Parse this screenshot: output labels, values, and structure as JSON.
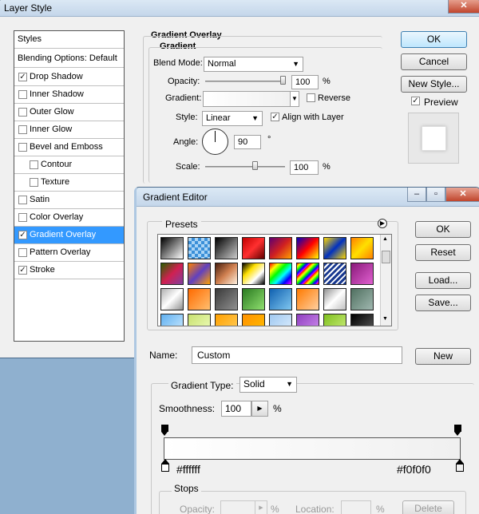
{
  "layer_style": {
    "title": "Layer Style",
    "styles_header": "Styles",
    "blending_options": "Blending Options: Default",
    "items": [
      {
        "label": "Drop Shadow",
        "checked": true,
        "indent": false,
        "selected": false
      },
      {
        "label": "Inner Shadow",
        "checked": false,
        "indent": false,
        "selected": false
      },
      {
        "label": "Outer Glow",
        "checked": false,
        "indent": false,
        "selected": false
      },
      {
        "label": "Inner Glow",
        "checked": false,
        "indent": false,
        "selected": false
      },
      {
        "label": "Bevel and Emboss",
        "checked": false,
        "indent": false,
        "selected": false
      },
      {
        "label": "Contour",
        "checked": false,
        "indent": true,
        "selected": false
      },
      {
        "label": "Texture",
        "checked": false,
        "indent": true,
        "selected": false
      },
      {
        "label": "Satin",
        "checked": false,
        "indent": false,
        "selected": false
      },
      {
        "label": "Color Overlay",
        "checked": false,
        "indent": false,
        "selected": false
      },
      {
        "label": "Gradient Overlay",
        "checked": true,
        "indent": false,
        "selected": true
      },
      {
        "label": "Pattern Overlay",
        "checked": false,
        "indent": false,
        "selected": false
      },
      {
        "label": "Stroke",
        "checked": true,
        "indent": false,
        "selected": false
      }
    ],
    "section_title": "Gradient Overlay",
    "subsection_title": "Gradient",
    "blend_mode_label": "Blend Mode:",
    "blend_mode_value": "Normal",
    "opacity_label": "Opacity:",
    "opacity_value": "100",
    "opacity_unit": "%",
    "opacity_level": 1.0,
    "gradient_label": "Gradient:",
    "reverse_label": "Reverse",
    "reverse_checked": false,
    "style_label": "Style:",
    "style_value": "Linear",
    "align_label": "Align with Layer",
    "align_checked": true,
    "angle_label": "Angle:",
    "angle_value": "90",
    "angle_unit": "°",
    "scale_label": "Scale:",
    "scale_value": "100",
    "scale_unit": "%",
    "scale_level": 0.4,
    "ok_label": "OK",
    "cancel_label": "Cancel",
    "new_style_label": "New Style...",
    "preview_label": "Preview",
    "preview_checked": true
  },
  "gradient_editor": {
    "title": "Gradient Editor",
    "presets_label": "Presets",
    "preset_swatches": [
      "linear-gradient(135deg,#000,#fff)",
      "repeating-conic-gradient(#3a8fd8 0 25%,#aad4f5 0 50%) 0 0/8px 8px",
      "linear-gradient(135deg,#000,#ccc)",
      "linear-gradient(135deg,#c00000,#ff3030,#600000)",
      "linear-gradient(135deg,#600070,#d02020,#ffa000)",
      "linear-gradient(135deg,#0000c0,#ff0000,#ffff00)",
      "linear-gradient(135deg,#ffd800,#0030c0,#ffd800)",
      "linear-gradient(135deg,#ff8000,#ffe000,#ff8000)",
      "linear-gradient(135deg,#2a6000,#d02050,#8040a0)",
      "linear-gradient(135deg,#ff8000,#6040c0,#ffa000)",
      "linear-gradient(135deg,#4a2010,#d08050,#fff0e0)",
      "linear-gradient(135deg,#000,#ffe000,#fff,#000)",
      "linear-gradient(135deg,#f00,#ff0,#0f0,#0ff,#00f,#f0f)",
      "repeating-linear-gradient(135deg,#f00,#ff0 3px,#0f0 6px,#00f 9px,#f0f 12px)",
      "repeating-linear-gradient(135deg,#1a3a90 0 3px,#fff 3px 5px)",
      "linear-gradient(135deg,#8a1a7a,#e060d0)",
      "linear-gradient(135deg,#b0b0b0,#fff,#909090)",
      "linear-gradient(135deg,#ff6a00,#ffc070)",
      "linear-gradient(135deg,#3a3a3a,#909090)",
      "linear-gradient(135deg,#2a7a20,#90e070)",
      "linear-gradient(135deg,#1060b0,#80c8f0)",
      "linear-gradient(135deg,#ff7a00,#ffd0a0)",
      "linear-gradient(135deg,#909090,#fff,#c0c0c0)",
      "linear-gradient(135deg,#507060,#a0b8b0)",
      "linear-gradient(135deg,#60b0f0,#d0ecff)",
      "linear-gradient(135deg,#c8e070,#f0ffc0)",
      "linear-gradient(135deg,#ffa000,#ffd060)",
      "linear-gradient(135deg,#ff9000,#ffc000)",
      "linear-gradient(135deg,#a0c8f0,#e0f0ff)",
      "linear-gradient(135deg,#9040c0,#d090f0)",
      "linear-gradient(135deg,#80c020,#d0f080)",
      "linear-gradient(135deg,#000,#606060)"
    ],
    "name_label": "Name:",
    "name_value": "Custom",
    "new_label": "New",
    "gradient_type_label": "Gradient Type:",
    "gradient_type_value": "Solid",
    "smoothness_label": "Smoothness:",
    "smoothness_value": "100",
    "smoothness_unit": "%",
    "left_stop_color": "#ffffff",
    "right_stop_color": "#f0f0f0",
    "stops_label": "Stops",
    "opacity_label": "Opacity:",
    "opacity_unit": "%",
    "location_label": "Location:",
    "location_unit": "%",
    "delete_label": "Delete",
    "ok_label": "OK",
    "reset_label": "Reset",
    "load_label": "Load...",
    "save_label": "Save..."
  }
}
